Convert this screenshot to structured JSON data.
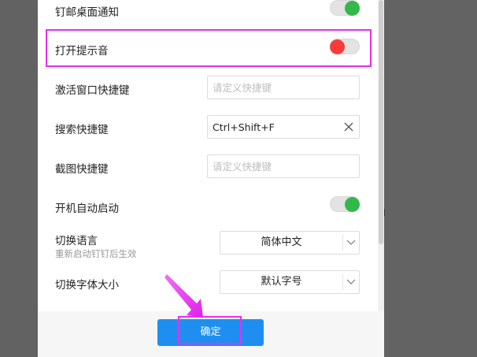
{
  "settings": {
    "desktop_notify_label": "钉邮桌面通知",
    "sound_label": "打开提示音",
    "activate_shortcut_label": "激活窗口快捷键",
    "activate_shortcut_placeholder": "请定义快捷键",
    "search_shortcut_label": "搜索快捷键",
    "search_shortcut_value": "Ctrl+Shift+F",
    "screenshot_shortcut_label": "截图快捷键",
    "screenshot_shortcut_placeholder": "请定义快捷键",
    "autostart_label": "开机自动启动",
    "language_label": "切换语言",
    "language_hint": "重新启动钉钉后生效",
    "language_value": "简体中文",
    "font_size_label": "切换字体大小",
    "font_size_value": "默认字号"
  },
  "toggles": {
    "desktop_notify": "on",
    "sound": "off",
    "autostart": "on"
  },
  "footer": {
    "ok_label": "确定"
  },
  "colors": {
    "toggle_on": "#33b84a",
    "toggle_off_knob": "#fa3b3b",
    "primary_button": "#1e8ff0",
    "highlight": "#e82ef0"
  }
}
